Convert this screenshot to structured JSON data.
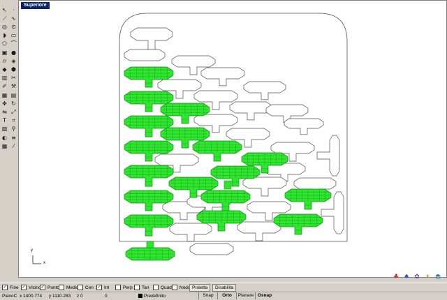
{
  "viewport": {
    "title": "Superiore"
  },
  "axes": {
    "x_label": "x",
    "y_label": "y"
  },
  "tools": [
    {
      "icon": "select-arrow-icon",
      "glyph": "↖"
    },
    {
      "icon": "point-icon",
      "glyph": "·"
    },
    {
      "icon": "polyline-icon",
      "glyph": "⟋"
    },
    {
      "icon": "curve-icon",
      "glyph": "∿"
    },
    {
      "icon": "circle-icon",
      "glyph": "◎"
    },
    {
      "icon": "ellipse-icon",
      "glyph": "⊙"
    },
    {
      "icon": "arc-icon",
      "glyph": "◗"
    },
    {
      "icon": "rectangle-icon",
      "glyph": "▭"
    },
    {
      "icon": "polygon-icon",
      "glyph": "⬠"
    },
    {
      "icon": "fillet-icon",
      "glyph": "⌒"
    },
    {
      "icon": "box-icon",
      "glyph": "▣"
    },
    {
      "icon": "sphere-icon",
      "glyph": "●"
    },
    {
      "icon": "cylinder-icon",
      "glyph": "⌭"
    },
    {
      "icon": "surface-icon",
      "glyph": "◈"
    },
    {
      "icon": "extrude-icon",
      "glyph": "◆"
    },
    {
      "icon": "solid-icon",
      "glyph": "⬢"
    },
    {
      "icon": "boolean-icon",
      "glyph": "▥"
    },
    {
      "icon": "split-icon",
      "glyph": "✂"
    },
    {
      "icon": "trim-icon",
      "glyph": "✐"
    },
    {
      "icon": "join-icon",
      "glyph": "⚒"
    },
    {
      "icon": "group-icon",
      "glyph": "▦"
    },
    {
      "icon": "array-icon",
      "glyph": "▤"
    },
    {
      "icon": "move-icon",
      "glyph": "✥"
    },
    {
      "icon": "rotate-icon",
      "glyph": "↻"
    },
    {
      "icon": "mirror-icon",
      "glyph": "⇋"
    },
    {
      "icon": "scale-icon",
      "glyph": "⤢"
    },
    {
      "icon": "text-icon",
      "glyph": "T"
    },
    {
      "icon": "dimension-icon",
      "glyph": "⌗"
    },
    {
      "icon": "layer-icon",
      "glyph": "▧"
    },
    {
      "icon": "analyze-icon",
      "glyph": "⚲"
    },
    {
      "icon": "render-icon",
      "glyph": "◐"
    },
    {
      "icon": "properties-icon",
      "glyph": "≡"
    },
    {
      "icon": "grid-icon",
      "glyph": "▦"
    },
    {
      "icon": "ruler-icon",
      "glyph": "⁄"
    }
  ],
  "osnap": {
    "items": [
      {
        "label": "Fine",
        "checked": true
      },
      {
        "label": "Vicino",
        "checked": true
      },
      {
        "label": "Punto",
        "checked": true
      },
      {
        "label": "Medio",
        "checked": false
      },
      {
        "label": "Cen",
        "checked": false
      },
      {
        "label": "Int",
        "checked": true
      },
      {
        "label": "Perp",
        "checked": false
      },
      {
        "label": "Tan",
        "checked": false
      },
      {
        "label": "Quad",
        "checked": false
      },
      {
        "label": "Nodo",
        "checked": false
      }
    ],
    "project_label": "Proietta",
    "disable_label": "Disabilita"
  },
  "status": {
    "plane": "PianoC",
    "x": "x 1400.774",
    "y": "y 1110.283",
    "z": "z 0",
    "value": "0",
    "layer": "Predefinito",
    "snap": "Snap",
    "ortho": "Orto",
    "planar": "Planare",
    "osnap": "Osnap"
  },
  "colors": {
    "selected_fill": "#2ee62e",
    "selected_mesh": "#118811",
    "outline": "#505050",
    "title_bar": "#0a246a"
  },
  "right_icons": [
    {
      "icon": "render-preview-icon",
      "glyph": "♣"
    },
    {
      "icon": "shade-icon",
      "glyph": "♠"
    },
    {
      "icon": "material-icon",
      "glyph": "✿"
    },
    {
      "icon": "light-icon",
      "glyph": "☀"
    },
    {
      "icon": "environment-icon",
      "glyph": "◓"
    }
  ]
}
